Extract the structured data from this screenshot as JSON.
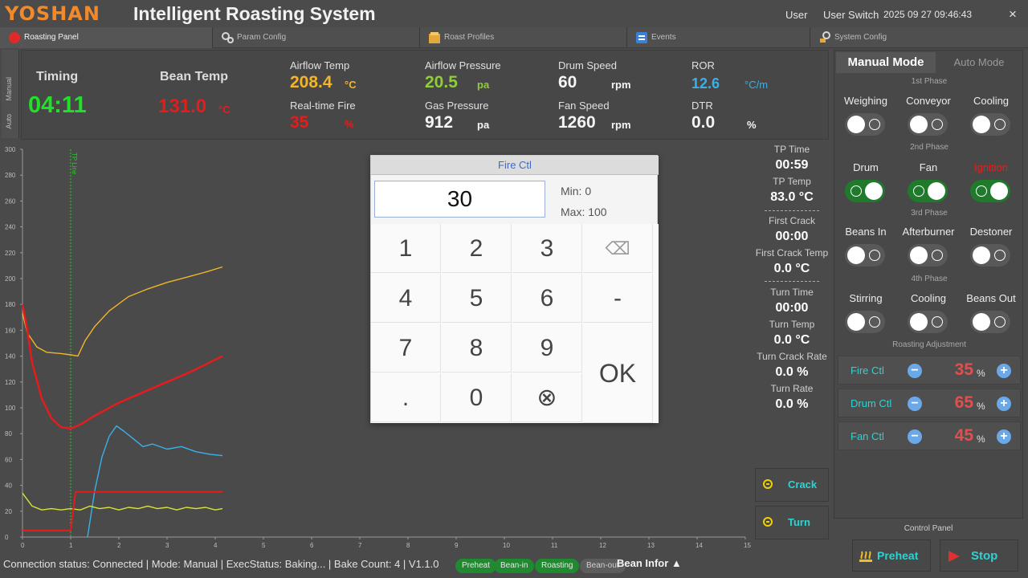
{
  "header": {
    "logo": "YOSHAN",
    "title": "Intelligent Roasting System",
    "user": "User",
    "user_switch": "User Switch",
    "datetime": "2025 09 27 09:46:43",
    "close": "×"
  },
  "tabs": [
    {
      "label": "Roasting Panel"
    },
    {
      "label": "Param Config"
    },
    {
      "label": "Roast Profiles"
    },
    {
      "label": "Events"
    },
    {
      "label": "System Config"
    }
  ],
  "side_tabs": {
    "manual": "Manual",
    "auto": "Auto"
  },
  "stats": {
    "timing_label": "Timing",
    "timing_value": "04:11",
    "bean_temp_label": "Bean Temp",
    "bean_temp_value": "131.0",
    "bean_temp_unit": "°C",
    "airflow_temp_label": "Airflow Temp",
    "airflow_temp_value": "208.4",
    "airflow_temp_unit": "°C",
    "realtime_fire_label": "Real-time Fire",
    "realtime_fire_value": "35",
    "realtime_fire_unit": "%",
    "airflow_pressure_label": "Airflow Pressure",
    "airflow_pressure_value": "20.5",
    "airflow_pressure_unit": "pa",
    "gas_pressure_label": "Gas Pressure",
    "gas_pressure_value": "912",
    "gas_pressure_unit": "pa",
    "drum_speed_label": "Drum Speed",
    "drum_speed_value": "60",
    "drum_speed_unit": "rpm",
    "fan_speed_label": "Fan Speed",
    "fan_speed_value": "1260",
    "fan_speed_unit": "rpm",
    "ror_label": "ROR",
    "ror_value": "12.6",
    "ror_unit": "°C/m",
    "dtr_label": "DTR",
    "dtr_value": "0.0",
    "dtr_unit": "%",
    "colors": {
      "timing": "#22e02a",
      "bean_temp": "#e51c1c",
      "airflow_temp": "#f2b52a",
      "airflow_pressure": "#8fce3a",
      "ror": "#3ab0e8",
      "fire": "#e51c1c"
    }
  },
  "chart_data": {
    "type": "line",
    "xlim": [
      0,
      15
    ],
    "ylim": [
      0,
      300
    ],
    "x_ticks": [
      0,
      1,
      2,
      3,
      4,
      5,
      6,
      7,
      8,
      9,
      10,
      11,
      12,
      13,
      14,
      15
    ],
    "y_ticks": [
      0,
      20,
      40,
      60,
      80,
      100,
      120,
      140,
      160,
      180,
      200,
      220,
      240,
      260,
      280,
      300
    ],
    "grid": false,
    "vline": {
      "x": 1.0,
      "label": "TP Line",
      "color": "#22d022"
    },
    "series": [
      {
        "color": "#f2b52a",
        "x": [
          0,
          0.1,
          0.3,
          0.5,
          0.8,
          1.0,
          1.15,
          1.3,
          1.5,
          1.8,
          2.2,
          2.6,
          3.0,
          3.4,
          3.8,
          4.15
        ],
        "y": [
          173,
          158,
          147,
          143,
          142,
          141,
          140,
          152,
          163,
          175,
          186,
          192,
          197,
          201,
          205,
          209
        ]
      },
      {
        "color": "#e51c1c",
        "x": [
          0,
          0.1,
          0.2,
          0.4,
          0.6,
          0.8,
          1.0,
          1.2,
          1.5,
          2.0,
          2.5,
          3.0,
          3.5,
          4.15
        ],
        "y": [
          180,
          160,
          135,
          107,
          92,
          85,
          84,
          87,
          94,
          104,
          112,
          120,
          128,
          140
        ]
      },
      {
        "color": "#3ab0e8",
        "x": [
          1.35,
          1.5,
          1.65,
          1.8,
          1.95,
          2.1,
          2.3,
          2.5,
          2.7,
          3.0,
          3.3,
          3.6,
          3.9,
          4.15
        ],
        "y": [
          0,
          36,
          62,
          78,
          86,
          82,
          76,
          70,
          72,
          68,
          70,
          66,
          64,
          63
        ]
      },
      {
        "color": "#d8e23a",
        "x": [
          0,
          0.2,
          0.4,
          0.6,
          0.8,
          1.0,
          1.2,
          1.4,
          1.6,
          1.8,
          2.0,
          2.2,
          2.4,
          2.6,
          2.8,
          3.0,
          3.2,
          3.4,
          3.6,
          3.8,
          4.0,
          4.15
        ],
        "y": [
          34,
          24,
          21,
          22,
          21,
          22,
          21,
          24,
          22,
          23,
          21,
          23,
          22,
          24,
          22,
          23,
          21,
          23,
          22,
          23,
          21,
          22
        ]
      },
      {
        "color": "#e51c1c",
        "x": [
          0,
          1.0,
          1.1,
          4.15
        ],
        "y": [
          5,
          5,
          35,
          35
        ]
      }
    ]
  },
  "summary": {
    "tp_time_label": "TP Time",
    "tp_time_value": "00:59",
    "tp_temp_label": "TP Temp",
    "tp_temp_value": "83.0 °C",
    "first_crack_label": "First Crack",
    "first_crack_value": "00:00",
    "first_crack_temp_label": "First Crack Temp",
    "first_crack_temp_value": "0.0 °C",
    "turn_time_label": "Turn Time",
    "turn_time_value": "00:00",
    "turn_temp_label": "Turn Temp",
    "turn_temp_value": "0.0 °C",
    "turn_crack_rate_label": "Turn Crack Rate",
    "turn_crack_rate_value": "0.0 %",
    "turn_rate_label": "Turn Rate",
    "turn_rate_value": "0.0 %",
    "crack_button": "Crack",
    "turn_button": "Turn"
  },
  "control": {
    "manual_mode": "Manual Mode",
    "auto_mode": "Auto Mode",
    "phase1": "1st Phase",
    "phase2": "2nd Phase",
    "phase3": "3rd Phase",
    "phase4": "4th Phase",
    "switches": [
      {
        "label": "Weighing",
        "on": false
      },
      {
        "label": "Conveyor",
        "on": false
      },
      {
        "label": "Cooling",
        "on": false
      },
      {
        "label": "Drum",
        "on": true
      },
      {
        "label": "Fan",
        "on": true
      },
      {
        "label": "Ignition",
        "on": true
      },
      {
        "label": "Beans In",
        "on": false
      },
      {
        "label": "Afterburner",
        "on": false
      },
      {
        "label": "Destoner",
        "on": false
      },
      {
        "label": "Stirring",
        "on": false
      },
      {
        "label": "Cooling",
        "on": false
      },
      {
        "label": "Beans Out",
        "on": false
      }
    ],
    "adjust_title": "Roasting Adjustment",
    "adjust": [
      {
        "label": "Fire Ctl",
        "value": "35",
        "unit": "%"
      },
      {
        "label": "Drum Ctl",
        "value": "65",
        "unit": "%"
      },
      {
        "label": "Fan Ctl",
        "value": "45",
        "unit": "%"
      }
    ],
    "panel_title": "Control Panel",
    "preheat_button": "Preheat",
    "stop_button": "Stop",
    "minus": "−",
    "plus": "+"
  },
  "status": {
    "text": "Connection status: Connected | Mode: Manual | ExecStatus: Baking... | Bake Count: 4 | V1.1.0",
    "phases": [
      {
        "label": "Preheat",
        "active": true
      },
      {
        "label": "Bean-in",
        "active": true
      },
      {
        "label": "Roasting",
        "active": true
      },
      {
        "label": "Bean-out",
        "active": false
      }
    ],
    "bean_info": "Bean Infor ▲"
  },
  "modal": {
    "title": "Fire Ctl",
    "value": "30",
    "min_label": "Min: 0",
    "max_label": "Max: 100",
    "keys": [
      "1",
      "2",
      "3",
      "⌫",
      "4",
      "5",
      "6",
      "-",
      "7",
      "8",
      "9",
      "OK",
      ".",
      "0",
      "⊗"
    ]
  }
}
